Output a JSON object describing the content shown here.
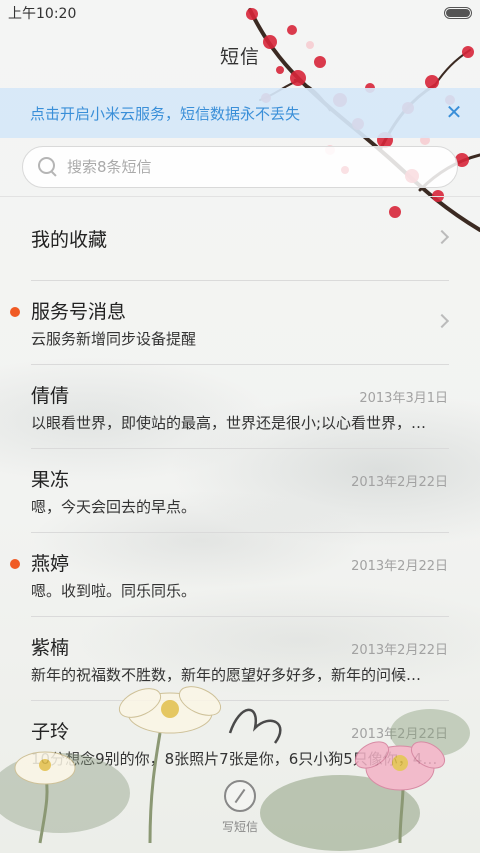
{
  "status_bar": {
    "time": "上午10:20",
    "battery_icon": "battery-icon"
  },
  "header": {
    "title": "短信"
  },
  "banner": {
    "text": "点击开启小米云服务，短信数据永不丢失",
    "close_icon": "close-icon"
  },
  "search": {
    "placeholder": "搜索8条短信"
  },
  "conversations": [
    {
      "name": "我的收藏",
      "snippet": "",
      "date": "",
      "unread": false,
      "chevron": true
    },
    {
      "name": "服务号消息",
      "snippet": "云服务新增同步设备提醒",
      "date": "",
      "unread": true,
      "chevron": true
    },
    {
      "name": "倩倩",
      "snippet": "以眼看世界，即使站的最高，世界还是很小;以心看世界，…",
      "date": "2013年3月1日",
      "unread": false
    },
    {
      "name": "果冻",
      "snippet": "嗯，今天会回去的早点。",
      "date": "2013年2月22日",
      "unread": false
    },
    {
      "name": "燕婷",
      "snippet": "嗯。收到啦。同乐同乐。",
      "date": "2013年2月22日",
      "unread": true
    },
    {
      "name": "紫楠",
      "snippet": "新年的祝福数不胜数，新年的愿望好多好多，新年的问候…",
      "date": "2013年2月22日",
      "unread": false
    },
    {
      "name": "子玲",
      "snippet": "10分想念9别的你，8张照片7张是你，6只小狗5只像你，4…",
      "date": "2013年2月22日",
      "unread": false
    }
  ],
  "compose": {
    "label": "写短信",
    "icon": "pen-icon"
  },
  "colors": {
    "accent": "#3a8fd8",
    "unread_dot": "#f05a24",
    "plum": "#d8263a"
  }
}
